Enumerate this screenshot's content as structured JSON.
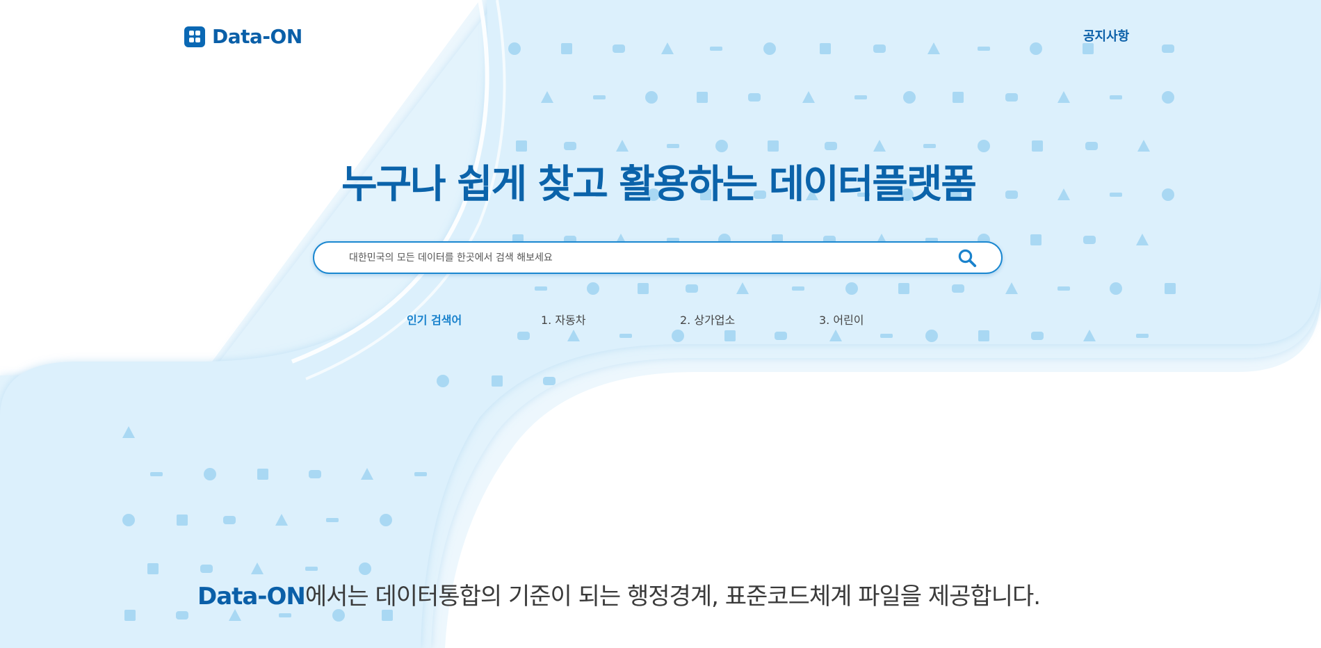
{
  "header": {
    "logo_text": "Data-ON",
    "notice_label": "공지사항"
  },
  "hero": {
    "headline": "누구나 쉽게 찾고 활용하는 데이터플랫폼"
  },
  "search": {
    "placeholder": "대한민국의 모든 데이터를 한곳에서 검색 해보세요"
  },
  "popular": {
    "label": "인기 검색어",
    "items": [
      "1. 자동차",
      "2. 상가업소",
      "3. 어린이"
    ]
  },
  "intro": {
    "brand": "Data-ON",
    "text": "에서는 데이터통합의 기준이 되는 행정경계, 표준코드체계 파일을 제공합니다."
  },
  "colors": {
    "brand": "#0a5fa8",
    "accent": "#1a87d0",
    "background_light": "#dff1fc",
    "pattern_icon": "#a9d8f3"
  },
  "icons": {
    "logo": "data-on-logo-icon",
    "search": "search-icon",
    "pattern": "decorative-icon-pattern"
  }
}
